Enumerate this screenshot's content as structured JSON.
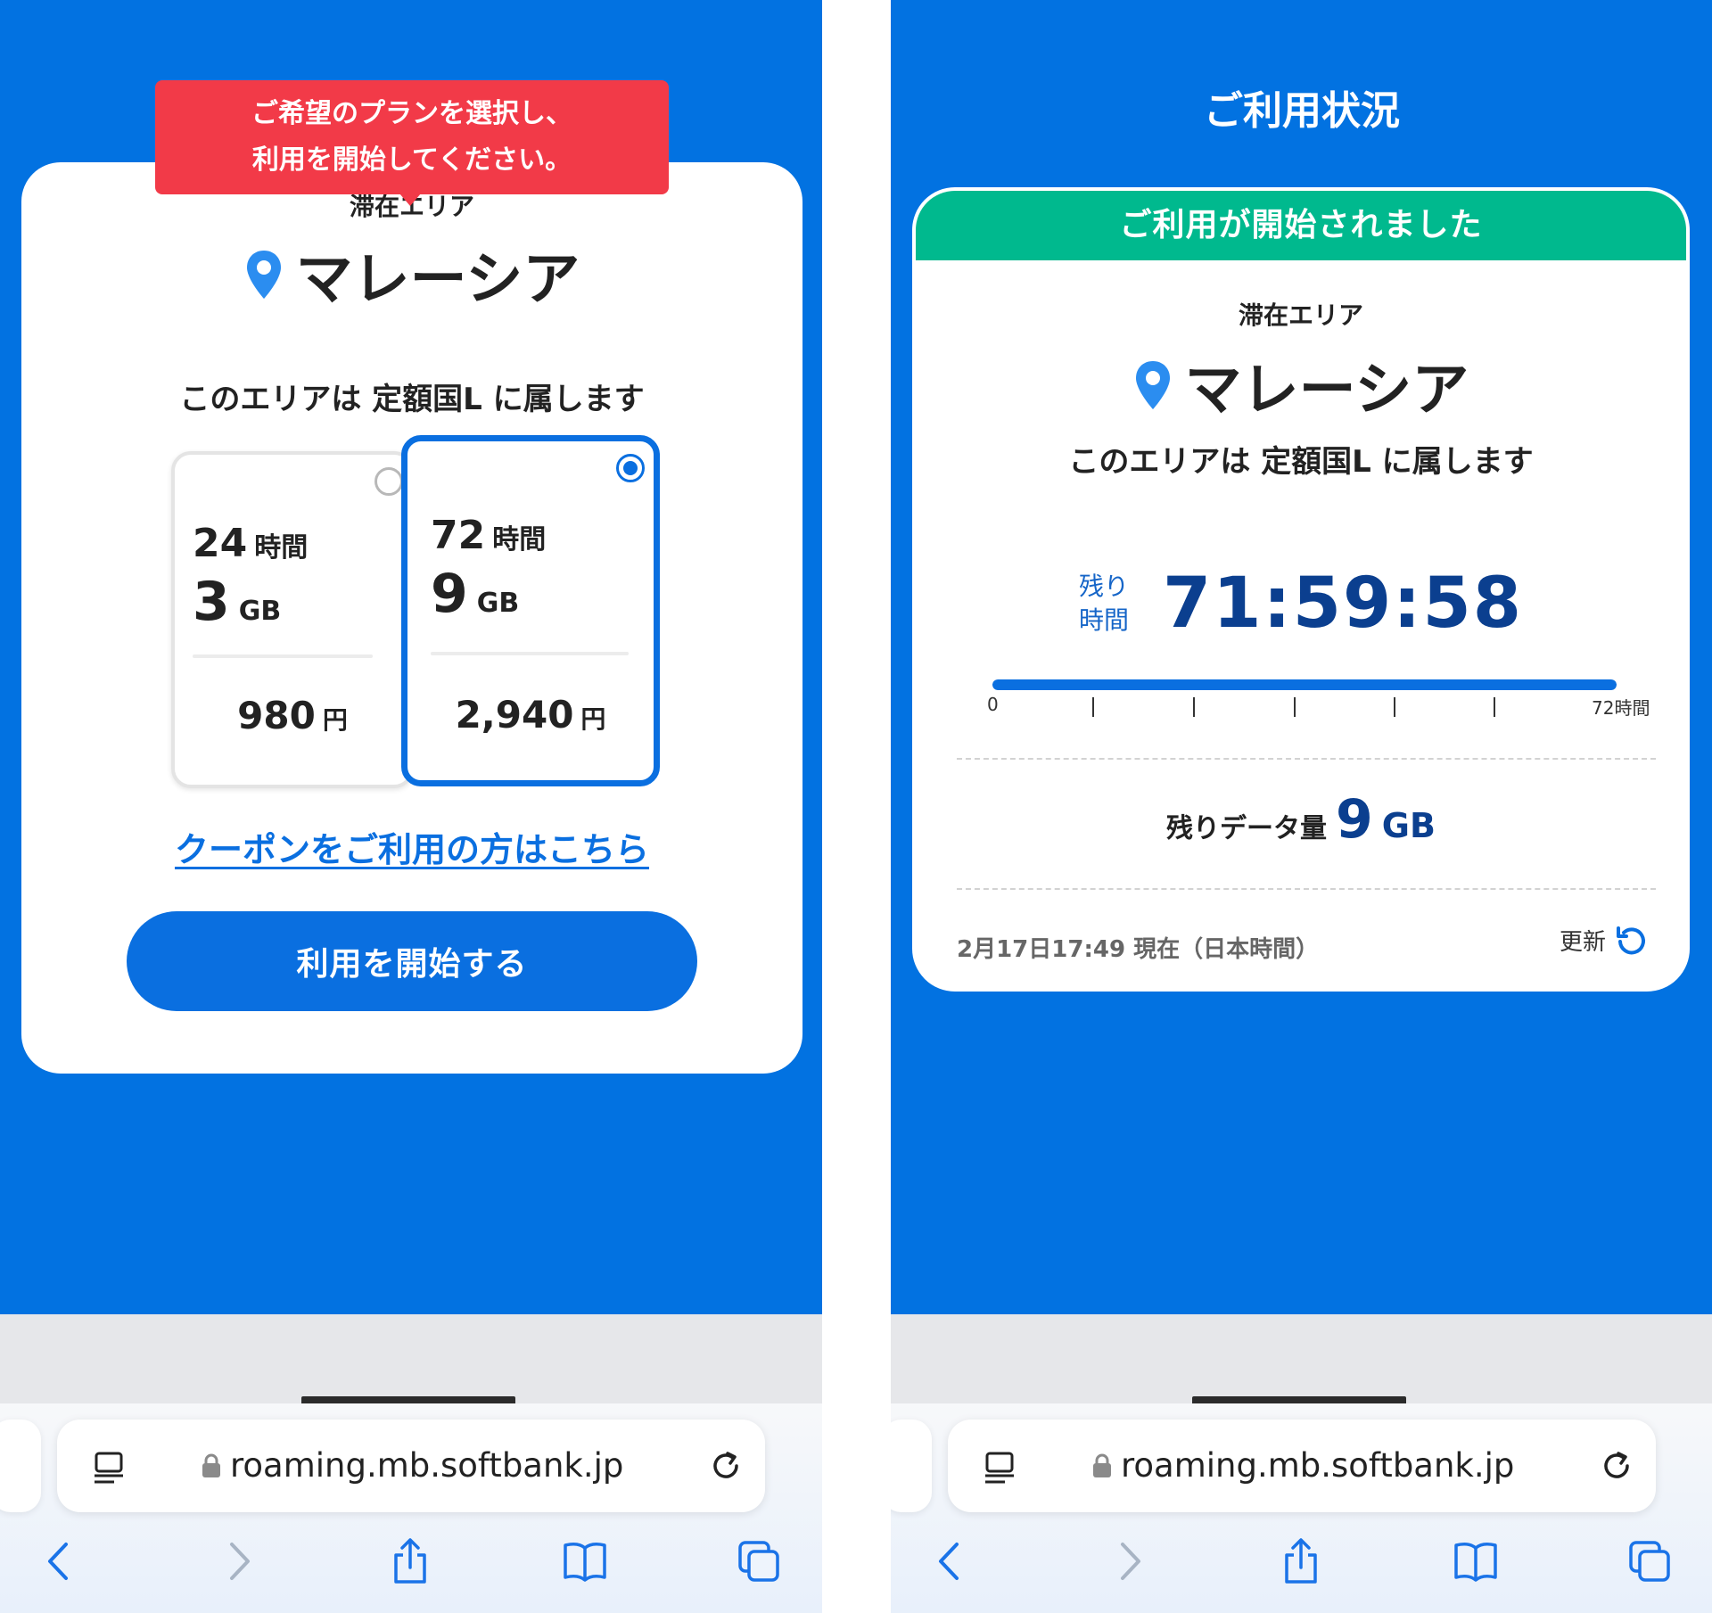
{
  "left": {
    "tooltip": {
      "line1": "ご希望のプランを選択し、",
      "line2": "利用を開始してください。"
    },
    "area_label": "滞在エリア",
    "country": "マレーシア",
    "belongs": "このエリアは 定額国L に属します",
    "plans": [
      {
        "hours": "24",
        "hours_unit": "時間",
        "gb": "3",
        "gb_unit": "GB",
        "price": "980",
        "price_unit": "円",
        "selected": false
      },
      {
        "hours": "72",
        "hours_unit": "時間",
        "gb": "9",
        "gb_unit": "GB",
        "price": "2,940",
        "price_unit": "円",
        "selected": true
      }
    ],
    "coupon_link": "クーポンをご利用の方はこちら",
    "start_button": "利用を開始する"
  },
  "right": {
    "title": "ご利用状況",
    "status_banner": "ご利用が開始されました",
    "area_label": "滞在エリア",
    "country": "マレーシア",
    "belongs": "このエリアは 定額国L に属します",
    "remaining_label_1": "残り",
    "remaining_label_2": "時間",
    "remaining_time": "71:59:58",
    "progress_fraction": 0.9999,
    "scale_start": "0",
    "scale_end": "72時間",
    "data_label": "残りデータ量",
    "data_value": "9",
    "data_unit": "GB",
    "timestamp": "2月17日17:49 現在（日本時間）",
    "refresh_label": "更新"
  },
  "browser": {
    "url": "roaming.mb.softbank.jp"
  },
  "colors": {
    "background_blue": "#0272e1",
    "accent_blue": "#0a6fe0",
    "tooltip_red": "#f23a48",
    "success_green": "#00b98e",
    "time_navy": "#0b3f8f"
  },
  "icons": [
    "location-pin-icon",
    "lock-icon",
    "reader-icon",
    "reload-icon",
    "back-icon",
    "forward-icon",
    "share-icon",
    "bookmarks-icon",
    "tabs-icon",
    "refresh-icon"
  ]
}
